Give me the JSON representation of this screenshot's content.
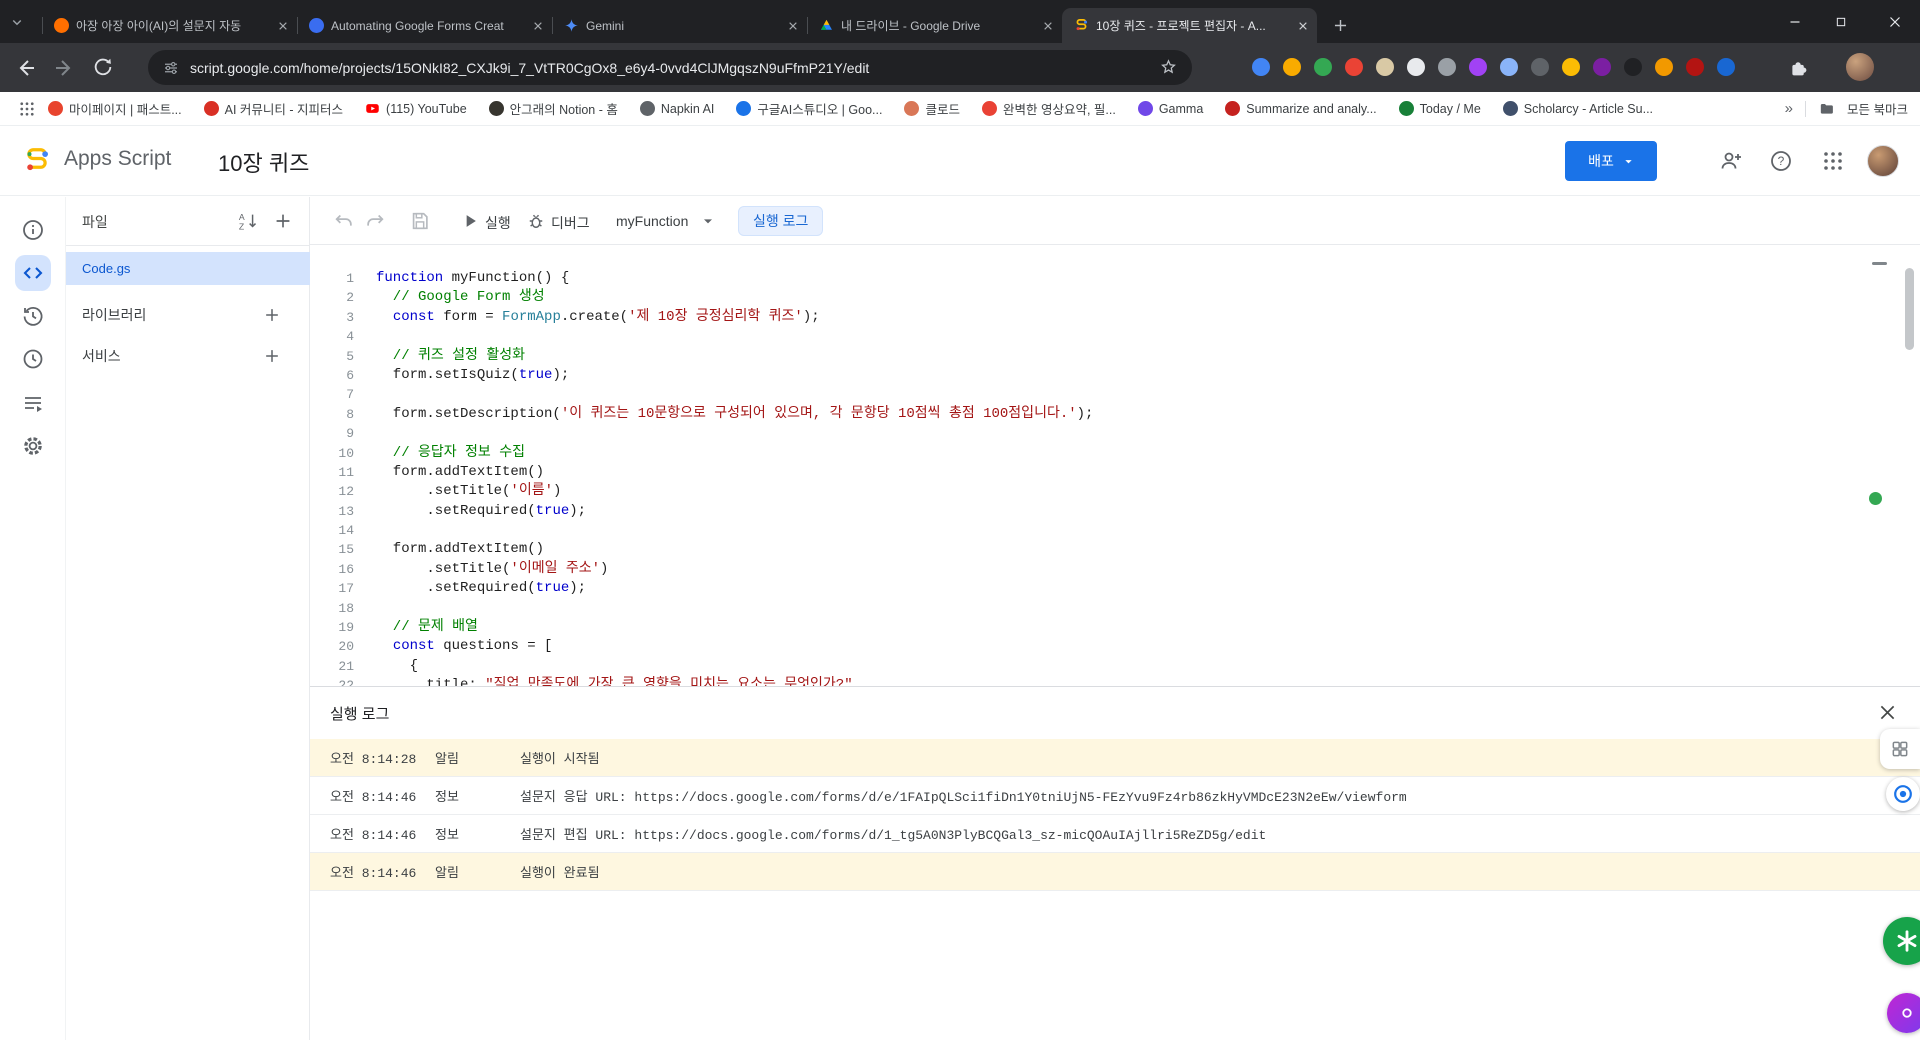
{
  "browser": {
    "tabs": [
      {
        "title": "아장 아장 아이(AI)의 설문지 자동",
        "icon": "circle",
        "color": "#ff6f00",
        "active": false
      },
      {
        "title": "Automating Google Forms Creat",
        "icon": "circle",
        "color": "#3a6df0",
        "active": false
      },
      {
        "title": "Gemini",
        "icon": "star",
        "color": "#4e8cf7",
        "active": false
      },
      {
        "title": "내 드라이브 - Google Drive",
        "icon": "drive",
        "color": "#ffba00",
        "active": false
      },
      {
        "title": "10장 퀴즈 - 프로젝트 편집자 - A...",
        "icon": "script",
        "color": "#f9ab00",
        "active": true
      }
    ],
    "url": "script.google.com/home/projects/15ONkI82_CXJk9i_7_VtTR0CgOx8_e6y4-0vvd4ClJMgqszN9uFfmP21Y/edit",
    "extensions": [
      "#4285f4",
      "#f9ab00",
      "#34a853",
      "#ea4335",
      "#d9c9a5",
      "#e8eaed",
      "#9aa0a6",
      "#a142f4",
      "#8ab4f8",
      "#5f6368",
      "#fbbc04",
      "#7b1fa2",
      "#202124",
      "#f29900",
      "#b31412",
      "#1967d2"
    ],
    "bookmarks": [
      {
        "label": "마이페이지 | 패스트...",
        "icon": "circle",
        "color": "#e8442e"
      },
      {
        "label": "AI 커뮤니티 - 지피터스",
        "icon": "circle",
        "color": "#d93025"
      },
      {
        "label": "(115) YouTube",
        "icon": "youtube",
        "color": "#ff0000"
      },
      {
        "label": "안그래의 Notion - 홈",
        "icon": "circle",
        "color": "#37352f"
      },
      {
        "label": "Napkin AI",
        "icon": "circle",
        "color": "#5f6368"
      },
      {
        "label": "구글AI스튜디오 | Goo...",
        "icon": "circle",
        "color": "#1a73e8"
      },
      {
        "label": "클로드",
        "icon": "circle",
        "color": "#d97757"
      },
      {
        "label": "완벽한 영상요약, 필...",
        "icon": "circle",
        "color": "#e94235"
      },
      {
        "label": "Gamma",
        "icon": "circle",
        "color": "#7048e8"
      },
      {
        "label": "Summarize and analy...",
        "icon": "circle",
        "color": "#c5221f"
      },
      {
        "label": "Today / Me",
        "icon": "circle",
        "color": "#188038"
      },
      {
        "label": "Scholarcy - Article Su...",
        "icon": "circle",
        "color": "#40506b"
      }
    ],
    "bookmarks_overflow": "»",
    "all_bookmarks_label": "모든 북마크"
  },
  "header": {
    "app_name": "Apps Script",
    "project_title": "10장 퀴즈",
    "deploy_label": "배포"
  },
  "sidebar": {
    "files_title": "파일",
    "files": [
      {
        "name": "Code.gs",
        "selected": true
      }
    ],
    "libraries_label": "라이브러리",
    "services_label": "서비스"
  },
  "toolbar": {
    "run_label": "실행",
    "debug_label": "디버그",
    "function_selector": "myFunction",
    "log_toggle_label": "실행 로그"
  },
  "editor": {
    "lines": [
      [
        [
          "k",
          "function"
        ],
        [
          "p",
          " myFunction() {"
        ]
      ],
      [
        [
          "c",
          "  // Google Form 생성"
        ]
      ],
      [
        [
          "p",
          "  "
        ],
        [
          "k",
          "const"
        ],
        [
          "p",
          " form = "
        ],
        [
          "t",
          "FormApp"
        ],
        [
          "p",
          ".create("
        ],
        [
          "s",
          "'제 10장 긍정심리학 퀴즈'"
        ],
        [
          "p",
          ");"
        ]
      ],
      [],
      [
        [
          "c",
          "  // 퀴즈 설정 활성화"
        ]
      ],
      [
        [
          "p",
          "  form.setIsQuiz("
        ],
        [
          "k",
          "true"
        ],
        [
          "p",
          ");"
        ]
      ],
      [],
      [
        [
          "p",
          "  form.setDescription("
        ],
        [
          "s",
          "'이 퀴즈는 10문항으로 구성되어 있으며, 각 문항당 10점씩 총점 100점입니다.'"
        ],
        [
          "p",
          ");"
        ]
      ],
      [],
      [
        [
          "c",
          "  // 응답자 정보 수집"
        ]
      ],
      [
        [
          "p",
          "  form.addTextItem()"
        ]
      ],
      [
        [
          "p",
          "      .setTitle("
        ],
        [
          "s",
          "'이름'"
        ],
        [
          "p",
          ")"
        ]
      ],
      [
        [
          "p",
          "      .setRequired("
        ],
        [
          "k",
          "true"
        ],
        [
          "p",
          ");"
        ]
      ],
      [],
      [
        [
          "p",
          "  form.addTextItem()"
        ]
      ],
      [
        [
          "p",
          "      .setTitle("
        ],
        [
          "s",
          "'이메일 주소'"
        ],
        [
          "p",
          ")"
        ]
      ],
      [
        [
          "p",
          "      .setRequired("
        ],
        [
          "k",
          "true"
        ],
        [
          "p",
          ");"
        ]
      ],
      [],
      [
        [
          "c",
          "  // 문제 배열"
        ]
      ],
      [
        [
          "p",
          "  "
        ],
        [
          "k",
          "const"
        ],
        [
          "p",
          " questions = ["
        ]
      ],
      [
        [
          "p",
          "    {"
        ]
      ],
      [
        [
          "p",
          "      title: "
        ],
        [
          "s",
          "\"직업 만족도에 가장 큰 영향을 미치는 요소는 무엇인가?\""
        ]
      ]
    ]
  },
  "log": {
    "title": "실행 로그",
    "rows": [
      {
        "time": "오전 8:14:28",
        "type": "알림",
        "message": "실행이 시작됨",
        "highlight": true
      },
      {
        "time": "오전 8:14:46",
        "type": "정보",
        "message": "설문지 응답 URL: https://docs.google.com/forms/d/e/1FAIpQLSci1fiDn1Y0tniUjN5-FEzYvu9Fz4rb86zkHyVMDcE23N2eEw/viewform",
        "highlight": false
      },
      {
        "time": "오전 8:14:46",
        "type": "정보",
        "message": "설문지 편집 URL: https://docs.google.com/forms/d/1_tg5A0N3PlyBCQGal3_sz-micQOAuIAjllri5ReZD5g/edit",
        "highlight": false
      },
      {
        "time": "오전 8:14:46",
        "type": "알림",
        "message": "실행이 완료됨",
        "highlight": true
      }
    ]
  },
  "colors": {
    "accent_blue": "#1a73e8",
    "selection_blue": "#d3e3fd",
    "log_highlight": "#fef7e0",
    "keyword": "#0000cc",
    "string": "#a31515",
    "comment": "#008000",
    "type": "#267f99"
  }
}
